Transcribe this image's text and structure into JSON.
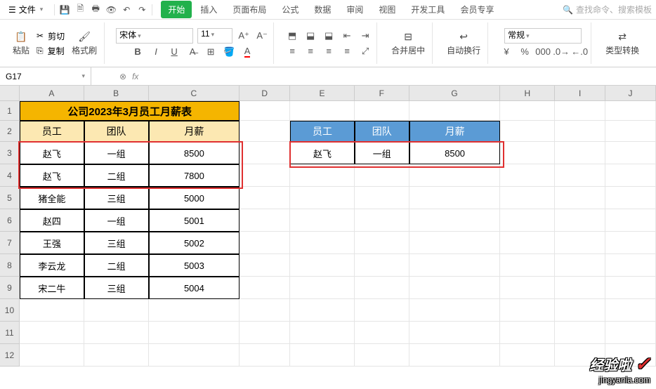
{
  "menubar": {
    "file": "文件",
    "tabs": [
      "开始",
      "插入",
      "页面布局",
      "公式",
      "数据",
      "审阅",
      "视图",
      "开发工具",
      "会员专享"
    ],
    "active_tab": 0,
    "search_placeholder": "查找命令、搜索模板"
  },
  "ribbon": {
    "paste": "粘贴",
    "cut": "剪切",
    "copy": "复制",
    "format_painter": "格式刷",
    "font_name": "宋体",
    "font_size": "11",
    "merge": "合并居中",
    "wrap": "自动换行",
    "number_format": "常规",
    "type_convert": "类型转换"
  },
  "namebox": {
    "cell_ref": "G17",
    "fx": "fx"
  },
  "columns": [
    "A",
    "B",
    "C",
    "D",
    "E",
    "F",
    "G",
    "H",
    "I",
    "J"
  ],
  "rows": [
    "1",
    "2",
    "3",
    "4",
    "5",
    "6",
    "7",
    "8",
    "9",
    "10",
    "11",
    "12"
  ],
  "table1": {
    "title": "公司2023年3月员工月薪表",
    "headers": [
      "员工",
      "团队",
      "月薪"
    ],
    "data": [
      [
        "赵飞",
        "一组",
        "8500"
      ],
      [
        "赵飞",
        "二组",
        "7800"
      ],
      [
        "猪全能",
        "三组",
        "5000"
      ],
      [
        "赵四",
        "一组",
        "5001"
      ],
      [
        "王强",
        "三组",
        "5002"
      ],
      [
        "李云龙",
        "二组",
        "5003"
      ],
      [
        "宋二牛",
        "三组",
        "5004"
      ]
    ]
  },
  "table2": {
    "headers": [
      "员工",
      "团队",
      "月薪"
    ],
    "data": [
      [
        "赵飞",
        "一组",
        "8500"
      ]
    ]
  },
  "watermark": {
    "brand": "经验啦",
    "url": "jingyanla.com"
  }
}
